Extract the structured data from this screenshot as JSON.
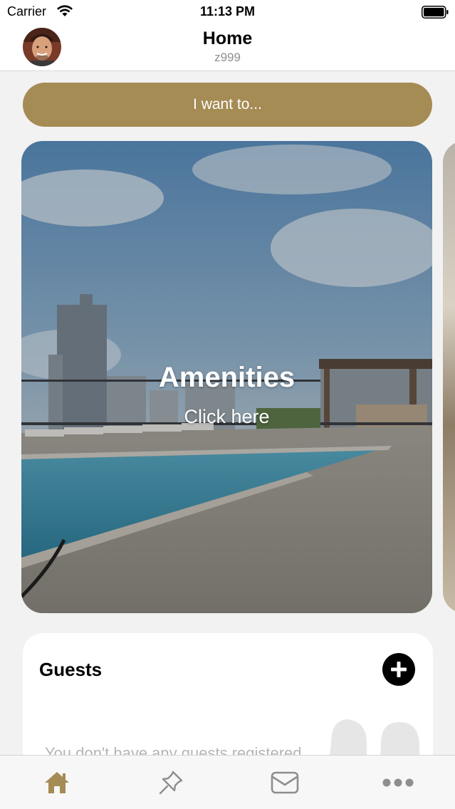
{
  "status_bar": {
    "carrier": "Carrier",
    "time": "11:13 PM",
    "wifi_icon": "wifi-icon",
    "battery_icon": "battery-icon"
  },
  "nav": {
    "title": "Home",
    "subtitle": "z999",
    "avatar_icon": "user-avatar"
  },
  "actions": {
    "want_to_label": "I want to..."
  },
  "carousel": {
    "cards": [
      {
        "title": "Amenities",
        "subtitle": "Click here",
        "image": "rooftop-pool-photo"
      }
    ]
  },
  "guests": {
    "title": "Guests",
    "empty_message": "You don't have any guests registered",
    "add_icon": "plus-circle-icon",
    "placeholder_icon": "people-silhouette-icon"
  },
  "tab_bar": {
    "items": [
      {
        "name": "home",
        "icon": "home-icon",
        "active": true
      },
      {
        "name": "pin",
        "icon": "pushpin-icon",
        "active": false
      },
      {
        "name": "messages",
        "icon": "envelope-icon",
        "active": false
      },
      {
        "name": "more",
        "icon": "more-dots-icon",
        "active": false
      }
    ]
  },
  "colors": {
    "accent": "#a58b54",
    "inactive_icon": "#8e8e8e",
    "background": "#f2f2f2"
  }
}
